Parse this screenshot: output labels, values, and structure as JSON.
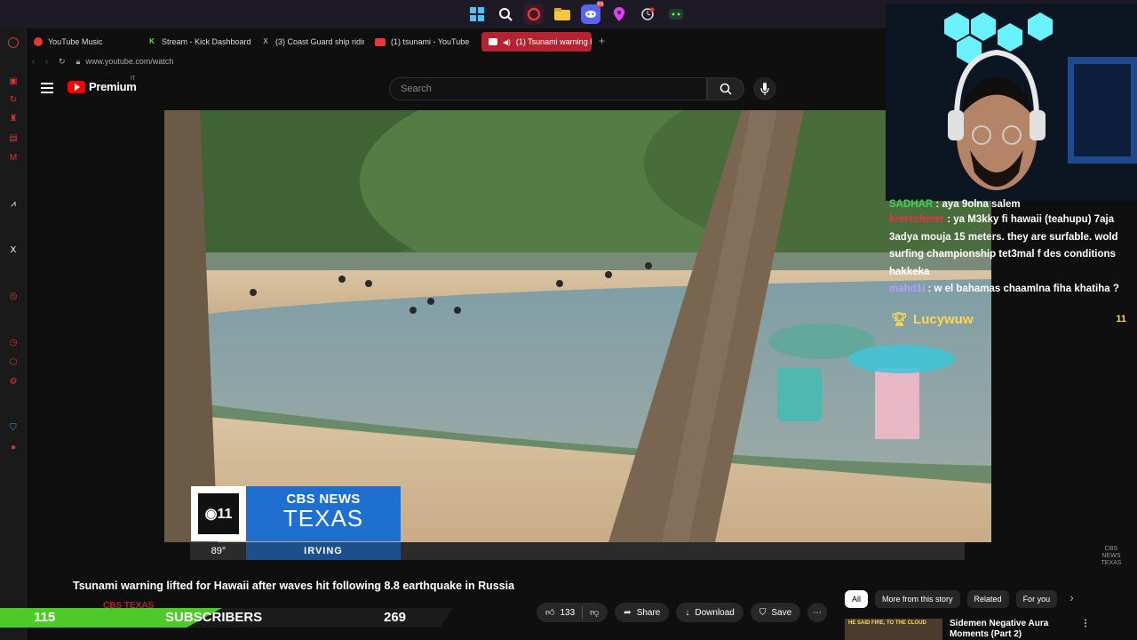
{
  "taskbar": {
    "icons": [
      "windows-icon",
      "search-icon",
      "opera-icon",
      "folder-icon",
      "discord-icon",
      "maps-icon",
      "clock-icon",
      "app-icon"
    ],
    "discord_badge": "93"
  },
  "tabs": [
    {
      "label": "YouTube Music",
      "icon": "youtube-music-icon",
      "color": "#e53935"
    },
    {
      "label": "Stream - Kick Dashboard",
      "icon": "kick-icon",
      "color": "#53fc18"
    },
    {
      "label": "(3) Coast Guard ship ridin",
      "icon": "x-icon",
      "color": "#ffffff"
    },
    {
      "label": "(1) tsunami - YouTube",
      "icon": "youtube-icon",
      "color": "#e53935"
    },
    {
      "label": "(1) Tsunami warning li",
      "icon": "youtube-icon",
      "color": "#ffffff",
      "active": true
    }
  ],
  "address": {
    "url": "www.youtube.com/watch"
  },
  "header": {
    "logo": "Premium",
    "logo_sup": "IT",
    "search_placeholder": "Search"
  },
  "video": {
    "overlay": {
      "news_brand": "CBS NEWS",
      "news_region": "TEXAS",
      "temperature": "89°",
      "city": "IRVING"
    },
    "watermark": "CBS NEWS TEXAS"
  },
  "title": "Tsunami warning lifted for Hawaii after waves hit following 8.8 earthquake in Russia",
  "channel_partial": "CBS TEXAS",
  "actions": {
    "likes": "133",
    "share": "Share",
    "download": "Download",
    "save": "Save"
  },
  "chips": [
    "All",
    "More from this story",
    "Related",
    "For you"
  ],
  "recommendation": {
    "title": "Sidemen Negative Aura Moments (Part 2)",
    "thumb_text": "HE SAID FIRE, TO THE CLOUD"
  },
  "subscriber_bar": {
    "left_count": "115",
    "label": "SUBSCRIBERS",
    "right_count": "269"
  },
  "chat": [
    {
      "user": "SADHAR",
      "user_color": "#3fd15b",
      "message": "aya 9olna salem"
    },
    {
      "user": "kretschmer",
      "user_color": "#e5334a",
      "message": "ya M3kky fi hawaii (teahupu) 7aja 3adya mouja 15 meters. they are surfable. wold surfing championship tet3mal f des conditions hakkeka"
    },
    {
      "user": "mahd1i",
      "user_color": "#b79cff",
      "message": "w el bahamas chaamlna fiha khatiha ?"
    }
  ],
  "gift": {
    "user": "Lucywuw",
    "count": "11"
  }
}
